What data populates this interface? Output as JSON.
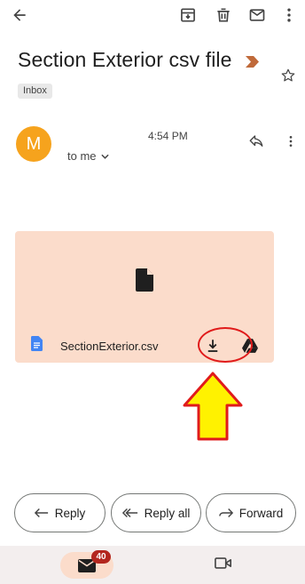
{
  "toolbar": {
    "back_icon": "back-arrow-icon",
    "archive_icon": "archive-icon",
    "delete_icon": "trash-icon",
    "unread_icon": "mark-unread-icon",
    "more_icon": "more-vertical-icon"
  },
  "email": {
    "subject": "Section Exterior csv file",
    "label": "Inbox",
    "sender_initial": "M",
    "sender_color": "#f6a31d",
    "time": "4:54 PM",
    "recipient": "to me"
  },
  "attachment": {
    "file_name": "SectionExterior.csv",
    "card_color": "#fbdccb"
  },
  "annotation": {
    "highlight_color": "#e01b1b",
    "arrow_fill": "#fff200"
  },
  "actions": {
    "reply_label": "Reply",
    "reply_all_label": "Reply all",
    "forward_label": "Forward"
  },
  "bottom_nav": {
    "mail_badge": "40",
    "badge_color": "#b3261e"
  }
}
